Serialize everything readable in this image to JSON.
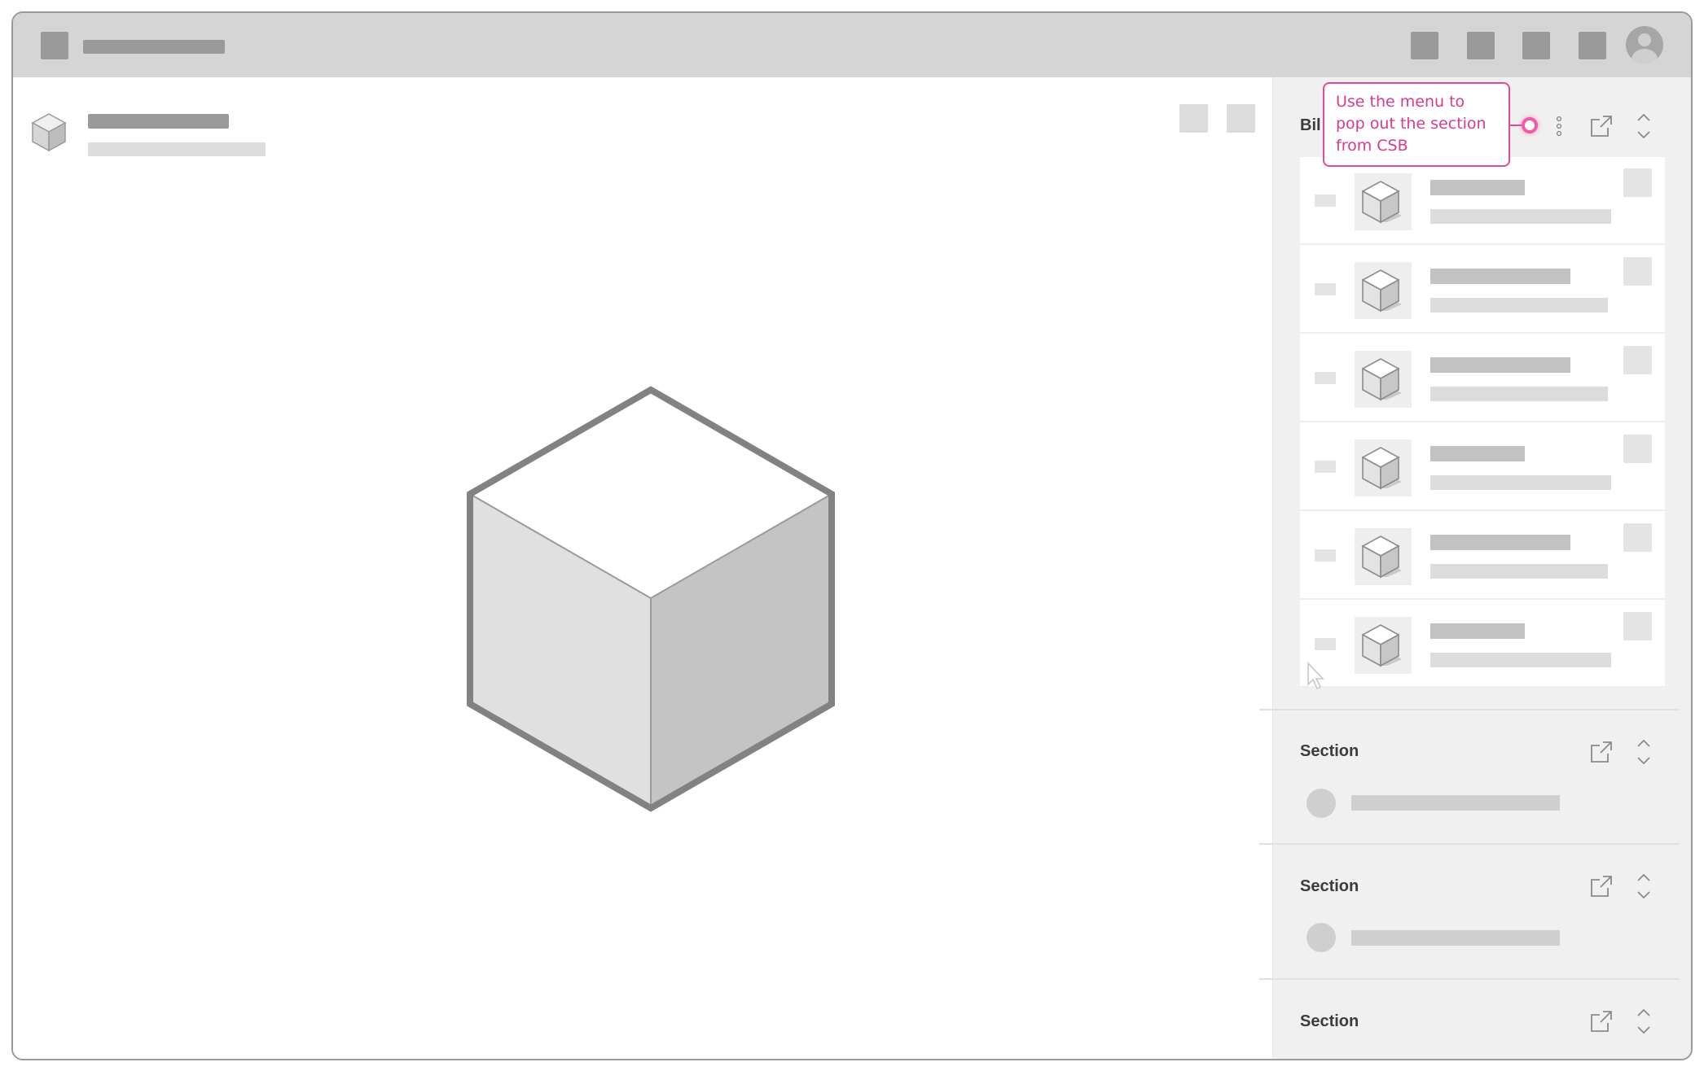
{
  "colors": {
    "accent": "#e24a96",
    "placeholder": "#a8a8a8",
    "panel_bg": "#f0f0f0",
    "topbar_bg": "#d5d5d5"
  },
  "panel": {
    "top_section": {
      "title": "Bil",
      "list_count": 6
    },
    "sections": [
      {
        "title": "Section"
      },
      {
        "title": "Section"
      },
      {
        "title": "Section"
      }
    ]
  },
  "tooltip": {
    "text": "Use the menu to pop out the section from CSB"
  },
  "icons": {
    "kebab": "kebab-menu-icon",
    "popout": "pop-out-icon",
    "collapse": "chevron-up-down-icon",
    "model": "cube-icon",
    "user": "user-avatar-icon"
  }
}
